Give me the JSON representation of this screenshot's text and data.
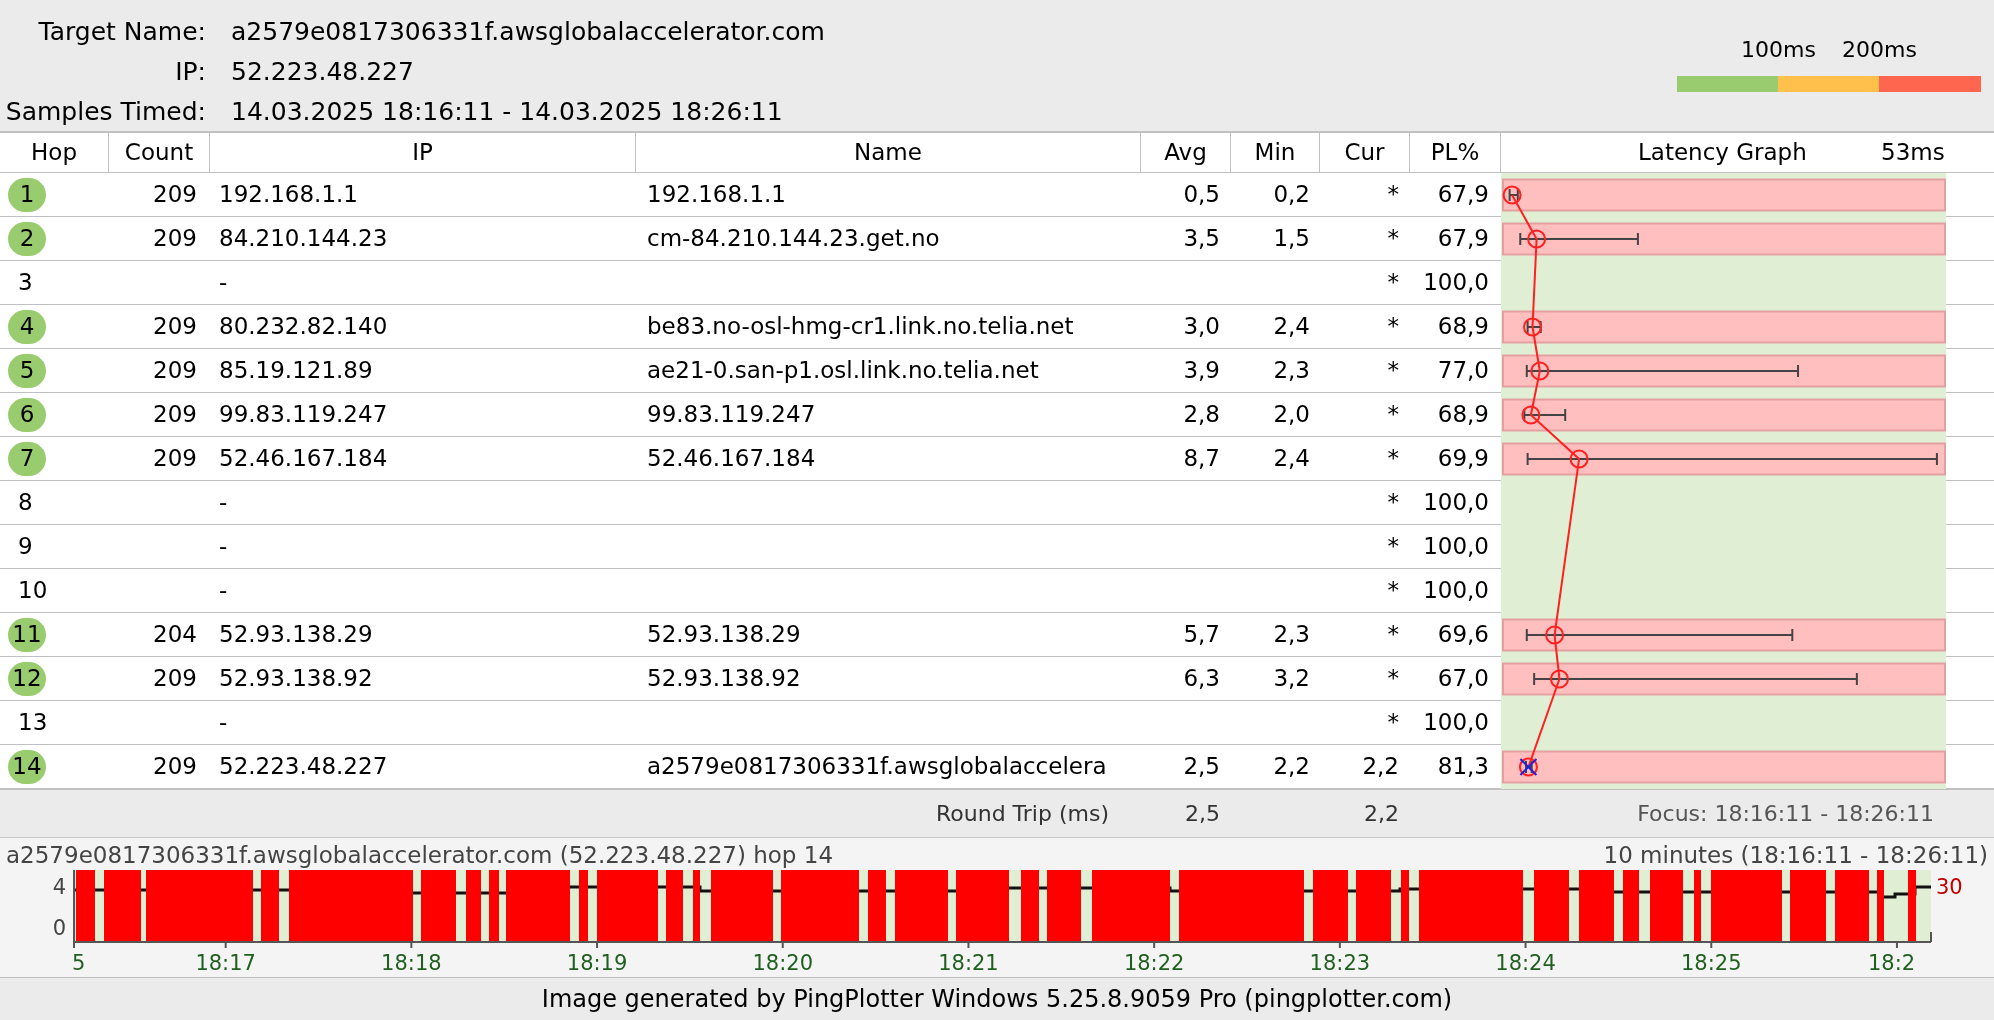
{
  "target": {
    "fields": [
      {
        "label": "Target Name:",
        "value": "a2579e0817306331f.awsglobalaccelerator.com"
      },
      {
        "label": "IP:",
        "value": "52.223.48.227"
      },
      {
        "label": "Samples Timed:",
        "value": "14.03.2025 18:16:11 - 14.03.2025 18:26:11"
      }
    ]
  },
  "legend": {
    "labels": [
      "100ms",
      "200ms"
    ]
  },
  "table": {
    "columns": [
      "Hop",
      "Count",
      "IP",
      "Name",
      "Avg",
      "Min",
      "Cur",
      "PL%",
      "Latency Graph"
    ],
    "graph_scale": "53ms",
    "rows": [
      {
        "hop": "1",
        "responded": true,
        "count": "209",
        "ip": "192.168.1.1",
        "name": "192.168.1.1",
        "avg": "0,5",
        "min": "0,2",
        "cur": "*",
        "pl": "67,9",
        "current_sample": false
      },
      {
        "hop": "2",
        "responded": true,
        "count": "209",
        "ip": "84.210.144.23",
        "name": "cm-84.210.144.23.get.no",
        "avg": "3,5",
        "min": "1,5",
        "cur": "*",
        "pl": "67,9",
        "current_sample": false
      },
      {
        "hop": "3",
        "responded": false,
        "ip": "-",
        "cur": "*",
        "pl": "100,0"
      },
      {
        "hop": "4",
        "responded": true,
        "count": "209",
        "ip": "80.232.82.140",
        "name": "be83.no-osl-hmg-cr1.link.no.telia.net",
        "avg": "3,0",
        "min": "2,4",
        "cur": "*",
        "pl": "68,9",
        "current_sample": false
      },
      {
        "hop": "5",
        "responded": true,
        "count": "209",
        "ip": "85.19.121.89",
        "name": "ae21-0.san-p1.osl.link.no.telia.net",
        "avg": "3,9",
        "min": "2,3",
        "cur": "*",
        "pl": "77,0",
        "current_sample": false
      },
      {
        "hop": "6",
        "responded": true,
        "count": "209",
        "ip": "99.83.119.247",
        "name": "99.83.119.247",
        "avg": "2,8",
        "min": "2,0",
        "cur": "*",
        "pl": "68,9",
        "current_sample": false
      },
      {
        "hop": "7",
        "responded": true,
        "count": "209",
        "ip": "52.46.167.184",
        "name": "52.46.167.184",
        "avg": "8,7",
        "min": "2,4",
        "cur": "*",
        "pl": "69,9",
        "current_sample": false
      },
      {
        "hop": "8",
        "responded": false,
        "ip": "-",
        "cur": "*",
        "pl": "100,0"
      },
      {
        "hop": "9",
        "responded": false,
        "ip": "-",
        "cur": "*",
        "pl": "100,0"
      },
      {
        "hop": "10",
        "responded": false,
        "ip": "-",
        "cur": "*",
        "pl": "100,0"
      },
      {
        "hop": "11",
        "responded": true,
        "count": "204",
        "ip": "52.93.138.29",
        "name": "52.93.138.29",
        "avg": "5,7",
        "min": "2,3",
        "cur": "*",
        "pl": "69,6",
        "current_sample": false
      },
      {
        "hop": "12",
        "responded": true,
        "count": "209",
        "ip": "52.93.138.92",
        "name": "52.93.138.92",
        "avg": "6,3",
        "min": "3,2",
        "cur": "*",
        "pl": "67,0",
        "current_sample": false
      },
      {
        "hop": "13",
        "responded": false,
        "ip": "-",
        "cur": "*",
        "pl": "100,0"
      },
      {
        "hop": "14",
        "responded": true,
        "count": "209",
        "ip": "52.223.48.227",
        "name": "a2579e0817306331f.awsglobalaccelera",
        "avg": "2,5",
        "min": "2,2",
        "cur": "2,2",
        "pl": "81,3",
        "current_sample": true
      }
    ]
  },
  "round_trip": {
    "label": "Round Trip (ms)",
    "avg": "2,5",
    "cur": "2,2",
    "focus": "Focus: 18:16:11 - 18:26:11"
  },
  "timeline": {
    "title": "a2579e0817306331f.awsglobalaccelerator.com (52.223.48.227) hop 14",
    "range": "10 minutes (18:16:11 - 18:26:11)",
    "y_labels": [
      "4",
      "0"
    ],
    "scale_label": "30",
    "x_labels": [
      "5",
      "18:17",
      "18:18",
      "18:19",
      "18:20",
      "18:21",
      "18:22",
      "18:23",
      "18:24",
      "18:25",
      "18:2"
    ]
  },
  "footer": "Image generated by PingPlotter Windows 5.25.8.9059 Pro (pingplotter.com)"
}
